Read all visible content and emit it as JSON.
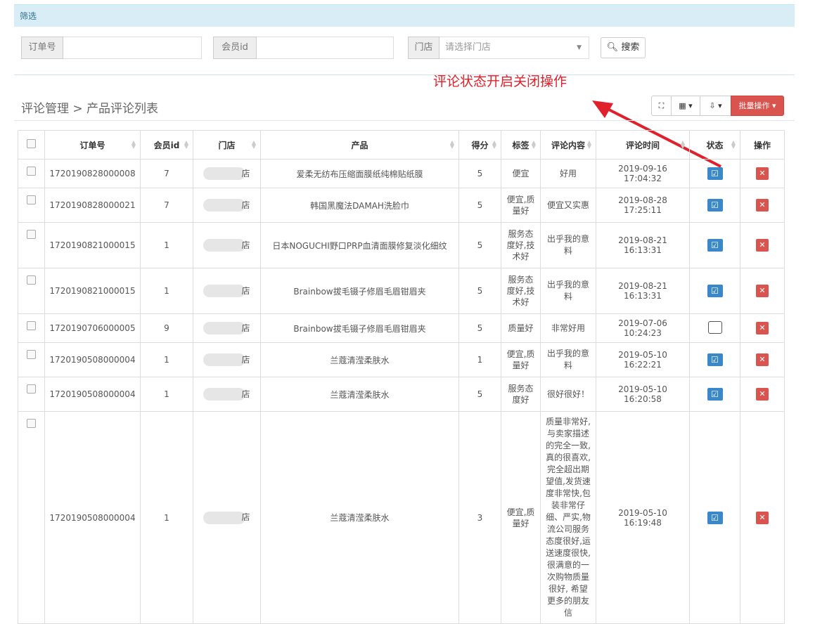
{
  "filter": {
    "title": "筛选"
  },
  "search": {
    "order_label": "订单号",
    "order_value": "",
    "member_label": "会员id",
    "member_value": "",
    "store_label": "门店",
    "store_placeholder": "请选择门店",
    "search_button": "搜索"
  },
  "annotation": "评论状态开启关闭操作",
  "breadcrumb": "评论管理 > 产品评论列表",
  "toolbar": {
    "batch_label": "批量操作"
  },
  "colors": {
    "accent": "#3a87c9",
    "danger": "#d9534f",
    "annotation": "#e0202a",
    "filter_bg": "#d9edf7"
  },
  "table": {
    "headers": [
      "订单号",
      "会员id",
      "门店",
      "产品",
      "得分",
      "标签",
      "评论内容",
      "评论时间",
      "状态",
      "操作"
    ],
    "rows": [
      {
        "order": "1720190828000008",
        "member": "7",
        "store": "店",
        "product": "爱柔无纺布压缩面膜纸纯棉贴纸膜",
        "score": "5",
        "tag": "便宜",
        "content": "好用",
        "time": "2019-09-16 17:04:32",
        "status": "on"
      },
      {
        "order": "1720190828000021",
        "member": "7",
        "store": "店",
        "product": "韩国黑魔法DAMAH洗脸巾",
        "score": "5",
        "tag": "便宜,质量好",
        "content": "便宜又实惠",
        "time": "2019-08-28 17:25:11",
        "status": "on"
      },
      {
        "order": "1720190821000015",
        "member": "1",
        "store": "店",
        "product": "日本NOGUCHI野口PRP血清面膜修复淡化细纹",
        "score": "5",
        "tag": "服务态度好,技术好",
        "content": "出乎我的意料",
        "time": "2019-08-21 16:13:31",
        "status": "on"
      },
      {
        "order": "1720190821000015",
        "member": "1",
        "store": "店",
        "product": "Brainbow拔毛镊子修眉毛眉钳眉夹",
        "score": "5",
        "tag": "服务态度好,技术好",
        "content": "出乎我的意料",
        "time": "2019-08-21 16:13:31",
        "status": "on"
      },
      {
        "order": "1720190706000005",
        "member": "9",
        "store": "店",
        "product": "Brainbow拔毛镊子修眉毛眉钳眉夹",
        "score": "5",
        "tag": "质量好",
        "content": "非常好用",
        "time": "2019-07-06 10:24:23",
        "status": "off"
      },
      {
        "order": "1720190508000004",
        "member": "1",
        "store": "店",
        "product": "兰蔻清滢柔肤水",
        "score": "1",
        "tag": "便宜,质量好",
        "content": "出乎我的意料",
        "time": "2019-05-10 16:22:21",
        "status": "on"
      },
      {
        "order": "1720190508000004",
        "member": "1",
        "store": "店",
        "product": "兰蔻清滢柔肤水",
        "score": "5",
        "tag": "服务态度好",
        "content": "很好很好！",
        "time": "2019-05-10 16:20:58",
        "status": "on"
      },
      {
        "order": "1720190508000004",
        "member": "1",
        "store": "店",
        "product": "兰蔻清滢柔肤水",
        "score": "3",
        "tag": "便宜,质量好",
        "content": "质量非常好,与卖家描述的完全一致,真的很喜欢,完全超出期望值,发货速度非常快,包装非常仔细、严实,物流公司服务态度很好,运送速度很快,很满意的一次购物质量很好, 希望更多的朋友信",
        "time": "2019-05-10 16:19:48",
        "status": "on"
      }
    ]
  }
}
